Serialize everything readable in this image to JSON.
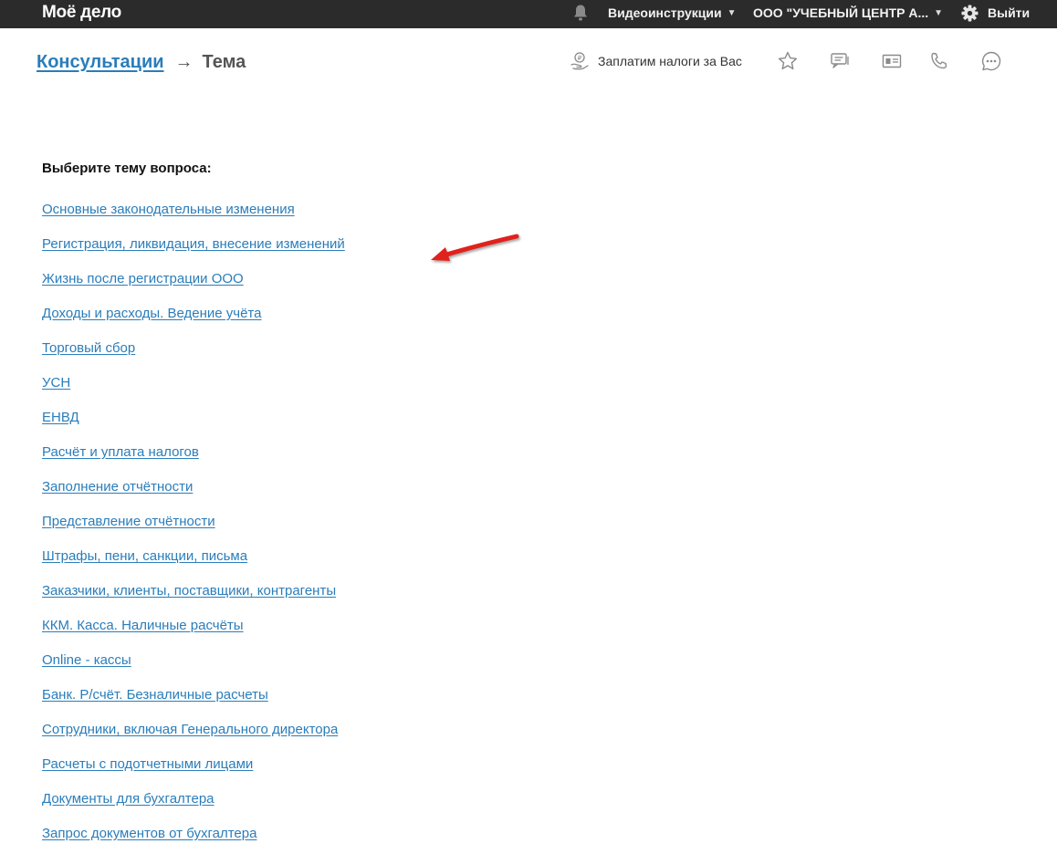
{
  "topbar": {
    "logo_text": "Моё дело",
    "video_label": "Видеоинструкции",
    "company_label": "ООО \"УЧЕБНЫЙ ЦЕНТР А...",
    "logout_label": "Выйти",
    "icons": [
      "bell-icon",
      "caret-down-icon",
      "gear-icon"
    ]
  },
  "header": {
    "breadcrumb_link": "Консультации",
    "breadcrumb_separator": "→",
    "breadcrumb_current": "Тема",
    "tax_label": "Заплатим налоги за Вас",
    "icons": [
      "pay-taxes-icon",
      "star-icon",
      "messages-icon",
      "id-card-icon",
      "phone-icon",
      "chat-icon"
    ]
  },
  "topics": {
    "title": "Выберите тему вопроса:",
    "items": [
      "Основные законодательные изменения",
      "Регистрация, ликвидация, внесение изменений",
      "Жизнь после регистрации ООО",
      "Доходы и расходы. Ведение учёта",
      "Торговый сбор",
      "УСН",
      "ЕНВД",
      "Расчёт и уплата налогов",
      "Заполнение отчётности",
      "Представление отчётности",
      "Штрафы, пени, санкции, письма",
      "Заказчики, клиенты, поставщики, контрагенты",
      "ККМ. Касса. Наличные расчёты",
      "Online - кассы",
      "Банк. Р/счёт. Безналичные расчеты",
      "Сотрудники, включая Генерального директора",
      "Расчеты с подотчетными лицами",
      "Документы для бухгалтера",
      "Запрос документов от бухгалтера"
    ]
  },
  "colors": {
    "topbar_bg": "#2b2b2b",
    "link": "#2a7dba",
    "annotation_arrow": "#e0201b"
  }
}
